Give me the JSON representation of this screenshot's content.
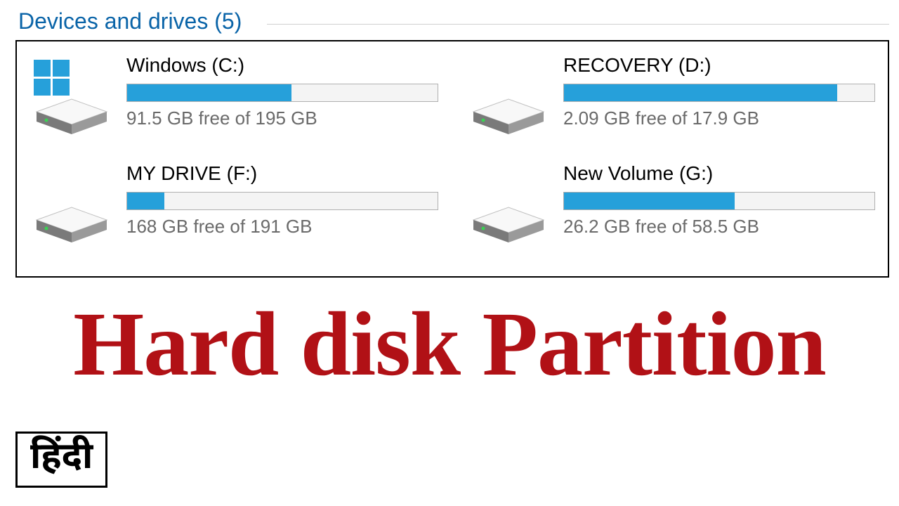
{
  "header": {
    "section_title": "Devices and drives (5)"
  },
  "drives": [
    {
      "name": "Windows (C:)",
      "status": "91.5 GB free of 195 GB",
      "fill_percent": 53,
      "has_windows_logo": true
    },
    {
      "name": "RECOVERY (D:)",
      "status": "2.09 GB free of 17.9 GB",
      "fill_percent": 88,
      "has_windows_logo": false
    },
    {
      "name": "MY DRIVE (F:)",
      "status": "168 GB free of 191 GB",
      "fill_percent": 12,
      "has_windows_logo": false
    },
    {
      "name": "New Volume (G:)",
      "status": "26.2 GB free of 58.5 GB",
      "fill_percent": 55,
      "has_windows_logo": false
    }
  ],
  "banner": {
    "title": "Hard disk Partition",
    "hindi_label": "हिंदी"
  },
  "colors": {
    "accent_blue": "#26a0da",
    "header_blue": "#0a64a8",
    "title_red": "#b11116"
  }
}
